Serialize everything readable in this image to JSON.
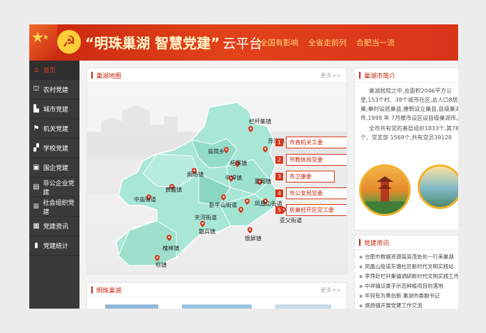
{
  "header": {
    "title": "“明珠巢湖  智慧党建”",
    "platform": "云平台",
    "slogans": [
      "全国有影响",
      "全省走前列",
      "合肥当一流"
    ]
  },
  "sidebar": {
    "items": [
      {
        "label": "首页",
        "icon": "home-icon"
      },
      {
        "label": "农村党建",
        "icon": "village-icon"
      },
      {
        "label": "城市党建",
        "icon": "city-icon"
      },
      {
        "label": "机关党建",
        "icon": "flag-icon"
      },
      {
        "label": "学校党建",
        "icon": "school-icon"
      },
      {
        "label": "国企党建",
        "icon": "company-icon"
      },
      {
        "label": "非公企业党建",
        "icon": "building-icon"
      },
      {
        "label": "社会组织党建",
        "icon": "network-icon"
      },
      {
        "label": "党建资讯",
        "icon": "news-icon"
      },
      {
        "label": "党建统计",
        "icon": "stats-icon"
      }
    ]
  },
  "map_panel": {
    "title": "巢湖地图",
    "more": "更多>>",
    "towns": [
      "栏杆集镇",
      "苏湾镇",
      "庙岗乡",
      "柘皋镇",
      "烔炀镇",
      "中垾镇",
      "夏阁镇",
      "黄麓镇",
      "中庙街道",
      "卧牛山街道",
      "凤凰山街道",
      "天河街道",
      "亚父街道",
      "散兵镇",
      "银屏镇",
      "槐林镇",
      "坝镇"
    ],
    "legend": [
      {
        "num": "1",
        "label": "市直机关工委"
      },
      {
        "num": "2",
        "label": "市教体局党委"
      },
      {
        "num": "3",
        "label": "市卫康委"
      },
      {
        "num": "4",
        "label": "市公安局党委"
      },
      {
        "num": "5",
        "label": "居巢经开区党工委"
      }
    ]
  },
  "intro_panel": {
    "title": "巢湖市简介",
    "paragraphs": [
      "巢湖居皖之中,总面积2046平方公里,153个村、38个城市社区,总人口8居巢;秦时设居巢县,唐朝设立巢县,县级巢湖市,1999 年 7月撤市设区设县级巢湖市。",
      "全市共有党的基层组织1833个,其78个、党支部 1569个,共有党员39128"
    ]
  },
  "news_panel": {
    "title": "党建资讯",
    "items": [
      "合肥市数据资源局吴茂处长一行来巢湖",
      "凤凰山街道东塘社区新时代文明实践站",
      "李萍赴栏杆集镇调研新时代文明实践工作",
      "中垾镇瓜豪子示范种植项目的落地",
      "年轻有为勇创新 巢湖市委副书记",
      "烔炀镇开展党建工作交流"
    ]
  },
  "bottom_panel": {
    "title": "明珠巢湖",
    "more": "更多>>"
  },
  "colors": {
    "accent": "#c8260f",
    "sidebar": "#3a3a3a",
    "map_fill": "#a8e6d6"
  }
}
